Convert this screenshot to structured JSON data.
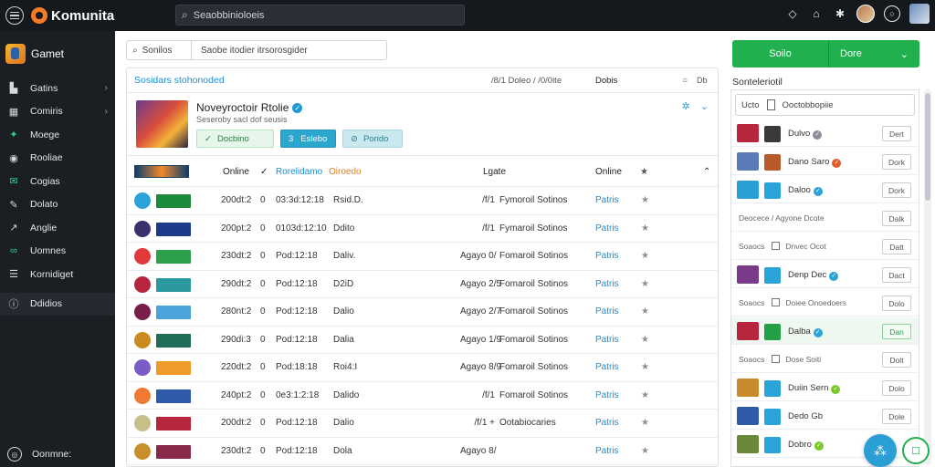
{
  "app": {
    "brand": "Komunita"
  },
  "topbar": {
    "search_text": "Seaobbinioloeis"
  },
  "sidebar": {
    "header": "Gamet",
    "items": [
      {
        "label": "Gatins",
        "icon": "store-icon",
        "chevron": true
      },
      {
        "label": "Comiris",
        "icon": "grid-icon",
        "chevron": true
      },
      {
        "label": "Moege",
        "icon": "gamepad-icon",
        "chevron": false
      },
      {
        "label": "Rooliae",
        "icon": "disc-icon",
        "chevron": false
      },
      {
        "label": "Cogias",
        "icon": "mail-icon",
        "chevron": false
      },
      {
        "label": "Dolato",
        "icon": "pen-icon",
        "chevron": false
      },
      {
        "label": "Anglie",
        "icon": "chart-icon",
        "chevron": false
      },
      {
        "label": "Uomnes",
        "icon": "link-icon",
        "chevron": false
      },
      {
        "label": "Kornidiget",
        "icon": "list-icon",
        "chevron": false
      },
      {
        "label": "Ddidios",
        "icon": "info-icon",
        "chevron": false
      }
    ],
    "footer": "Oonmne:"
  },
  "main": {
    "filter": {
      "left": "Sonilos",
      "right": "Saobe itodier itrsorosgider"
    },
    "card_head": {
      "link": "Sosidars stohonoded",
      "mid": "/8/1 Doleo /  /0/0ite",
      "label": "Dobis",
      "small": "Db"
    },
    "feature": {
      "title": "Noveyroctoir Rtolie",
      "subtitle": "Seseroby sacl dof seusis",
      "btn1": "Docbino",
      "btn2": "Eslebo",
      "btn3": "Porido"
    },
    "table": {
      "headers": {
        "online": "Online",
        "col2": "Rorelidamo",
        "col3": "Oiroedo",
        "lgate": "Lgate",
        "online2": "Online"
      },
      "rows": [
        {
          "date": "200dt:2",
          "num": "0",
          "time": "03:3d:12:18",
          "status": "Rsid.D.",
          "loc": "/f/1",
          "desc": "Fymoroil Sotinos",
          "pub": "Patris",
          "icon_c": "#2aa3d8",
          "banner_c": "#1e8a3c"
        },
        {
          "date": "200pt:2",
          "num": "0",
          "time": "0103d:12:10",
          "status": "Ddito",
          "loc": "/f/1",
          "desc": "Fymaroil Sotinos",
          "pub": "Patris",
          "icon_c": "#3b2f6e",
          "banner_c": "#1c3b8a"
        },
        {
          "date": "230dt:2",
          "num": "0",
          "time": "Pod:12:18",
          "status": "Daliv.",
          "loc": "Agayo 0/",
          "desc": "Fomaroil Sotinos",
          "pub": "Patris",
          "icon_c": "#e03a3a",
          "banner_c": "#2ea04a"
        },
        {
          "date": "290dt:2",
          "num": "0",
          "time": "Pod:12:18",
          "status": "D2iD",
          "loc": "Agayo 2/5",
          "desc": "Fomaroil Sotinos",
          "pub": "Patris",
          "icon_c": "#b8263d",
          "banner_c": "#2a9a9f"
        },
        {
          "date": "280nt:2",
          "num": "0",
          "time": "Pod:12:18",
          "status": "Dalio",
          "loc": "Agayo 2/7",
          "desc": "Fomaroil Sotinos",
          "pub": "Patris",
          "icon_c": "#7a1e4a",
          "banner_c": "#4aa3d9"
        },
        {
          "date": "290di:3",
          "num": "0",
          "time": "Pod:12:18",
          "status": "Dalia",
          "loc": "Agayo 1/9",
          "desc": "Fomaroil Sotinos",
          "pub": "Patris",
          "icon_c": "#c98a1f",
          "banner_c": "#1f6e5a"
        },
        {
          "date": "220dt:2",
          "num": "0",
          "time": "Pod:18:18",
          "status": "Roi4:I",
          "loc": "Agayo 8/9",
          "desc": "Fomaroil Sotinos",
          "pub": "Patris",
          "icon_c": "#7a5cc8",
          "banner_c": "#f09a2a"
        },
        {
          "date": "240pt:2",
          "num": "0",
          "time": "0e3:1:2:18",
          "status": "Dalido",
          "loc": "/f/1",
          "desc": "Fomaroil Sotinos",
          "pub": "Patris",
          "icon_c": "#f07a32",
          "banner_c": "#2f5aa8"
        },
        {
          "date": "200dt:2",
          "num": "0",
          "time": "Pod:12:18",
          "status": "Dalio",
          "loc": "/f/1 +",
          "desc": "Ootabiocaries",
          "pub": "Patris",
          "icon_c": "#c8c08a",
          "banner_c": "#b8263d"
        },
        {
          "date": "230dt:2",
          "num": "0",
          "time": "Pod:12:18",
          "status": "Dola",
          "loc": "Agayo 8/",
          "desc": "",
          "pub": "Patris",
          "icon_c": "#c88f2a",
          "banner_c": "#8a2a4a"
        }
      ]
    }
  },
  "right_panel": {
    "btn_a": "Soilo",
    "btn_b": "Dore",
    "title": "Sonteleriotil",
    "search": {
      "left": "Ucto",
      "right": "Ooctobbopiie"
    },
    "rows": [
      {
        "type": "game",
        "name": "Dulvo",
        "badge": "#8a8f96",
        "btn": "Dert",
        "c1": "#b8263d",
        "c2": "#3a3a3a",
        "hl": false,
        "btn_green": false
      },
      {
        "type": "game",
        "name": "Dano  Saro",
        "badge": "#e05a2a",
        "btn": "Dork",
        "c1": "#5a7ab8",
        "c2": "#b85a2a",
        "hl": false,
        "btn_green": false
      },
      {
        "type": "game",
        "name": "Daloo",
        "badge": "#2aa3d8",
        "btn": "Dork",
        "c1": "#2a9fd6",
        "c2": "#2aa3d8",
        "hl": false,
        "btn_green": false
      },
      {
        "type": "plain",
        "name": "Deocece / Agyone Dcote",
        "btn": "Dalk"
      },
      {
        "type": "check",
        "name": "Dnvec Ocot",
        "btn": "Datt"
      },
      {
        "type": "game",
        "name": "Denp  Dec",
        "badge": "#2aa3d8",
        "btn": "Dact",
        "c1": "#7a3a8a",
        "c2": "#2aa3d8",
        "hl": false,
        "btn_green": false
      },
      {
        "type": "check",
        "name": "Doiee Onoedoers",
        "btn": "Dolo"
      },
      {
        "type": "game",
        "name": "Dalba",
        "badge": "#2aa3d8",
        "btn": "Dan",
        "c1": "#b8263d",
        "c2": "#22a046",
        "hl": true,
        "btn_green": true
      },
      {
        "type": "check",
        "name": "Dose Soiti",
        "btn": "Dolt"
      },
      {
        "type": "game",
        "name": "Duiin  Sern",
        "badge": "#7ac82a",
        "btn": "Dolo",
        "c1": "#c88a2a",
        "c2": "#2aa3d8",
        "hl": false,
        "btn_green": false
      },
      {
        "type": "game",
        "name": "Dedo Gb",
        "badge": "",
        "btn": "Dole",
        "c1": "#2f5aa8",
        "c2": "#2aa3d8",
        "hl": false,
        "btn_green": false
      },
      {
        "type": "game",
        "name": "Dobro",
        "badge": "#7ac82a",
        "btn": "",
        "c1": "#6a8a3a",
        "c2": "#2aa3d8",
        "hl": false,
        "btn_green": false
      }
    ]
  },
  "colors": {
    "accent_green": "#22b04f",
    "accent_blue": "#1b8ed8",
    "orange": "#e0801f",
    "topbar_bg": "#15181d",
    "sidebar_bg": "#1b1e23"
  }
}
